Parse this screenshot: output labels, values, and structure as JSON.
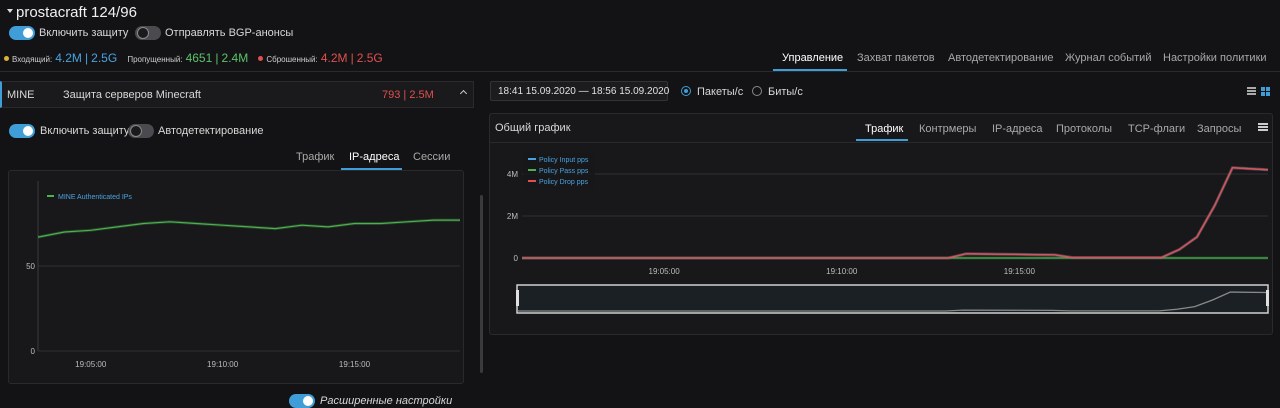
{
  "header": {
    "title": "prostacraft 124/96",
    "enable_protection": "Включить защиту",
    "send_bgp": "Отправлять BGP-анонсы"
  },
  "stats": {
    "incoming_label": "Входящий:",
    "incoming_pps": "4.2M",
    "incoming_bps": "2.5G",
    "passed_label": "Пропущенный:",
    "passed_pps": "4651",
    "passed_bps": "2.4M",
    "dropped_label": "Сброшенный:",
    "dropped_pps": "4.2M",
    "dropped_bps": "2.5G",
    "sep": "|"
  },
  "main_tabs": [
    "Управление",
    "Захват пакетов",
    "Автодетектирование",
    "Журнал событий",
    "Настройки политики"
  ],
  "policy": {
    "name": "MINE",
    "description": "Защита серверов Minecraft",
    "value_pps": "793",
    "value_bps": "2.5M",
    "enable_protection": "Включить защиту",
    "autodetect": "Автодетектирование",
    "tabs": [
      "Трафик",
      "IP-адреса",
      "Сессии"
    ],
    "advanced_settings": "Расширенные настройки"
  },
  "time_range": "18:41 15.09.2020 — 18:56 15.09.2020",
  "units": {
    "packets": "Пакеты/с",
    "bits": "Биты/с",
    "selected": "packets"
  },
  "general_chart": {
    "title": "Общий график",
    "tabs": [
      "Трафик",
      "Контрмеры",
      "IP-адреса",
      "Протоколы",
      "TCP-флаги",
      "Запросы"
    ]
  },
  "chart_data": [
    {
      "type": "line",
      "title": "",
      "series": [
        {
          "name": "MINE Authenticated IPs",
          "color": "#4caf50",
          "x": [
            "19:03",
            "19:04",
            "19:05",
            "19:06",
            "19:07",
            "19:08",
            "19:09",
            "19:10",
            "19:11",
            "19:12",
            "19:13",
            "19:14",
            "19:15",
            "19:16",
            "19:17",
            "19:18",
            "19:19"
          ],
          "values": [
            67,
            70,
            71,
            73,
            75,
            76,
            75,
            74,
            73,
            72,
            74,
            73,
            75,
            75,
            76,
            77,
            77
          ]
        }
      ],
      "x_ticks": [
        "19:05:00",
        "19:10:00",
        "19:15:00"
      ],
      "y_ticks": [
        "0",
        "50"
      ],
      "ylim": [
        0,
        100
      ],
      "legend": "top-left"
    },
    {
      "type": "line",
      "title": "",
      "series": [
        {
          "name": "Policy Input pps",
          "color": "#4aa3df",
          "x": [
            "19:01",
            "19:05",
            "19:10",
            "19:13",
            "19:13.5",
            "19:16",
            "19:16.5",
            "19:19",
            "19:19.5",
            "19:20",
            "19:20.5",
            "19:21",
            "19:22"
          ],
          "values": [
            0,
            0,
            0,
            0,
            0.2,
            0.15,
            0.02,
            0.02,
            0.4,
            1.0,
            2.5,
            4.3,
            4.2
          ]
        },
        {
          "name": "Policy Pass pps",
          "color": "#4caf50",
          "x": [
            "19:01",
            "19:22"
          ],
          "values": [
            0,
            0
          ]
        },
        {
          "name": "Policy Drop pps",
          "color": "#e05050",
          "x": [
            "19:01",
            "19:05",
            "19:10",
            "19:13",
            "19:13.5",
            "19:16",
            "19:16.5",
            "19:19",
            "19:19.5",
            "19:20",
            "19:20.5",
            "19:21",
            "19:22"
          ],
          "values": [
            0,
            0,
            0,
            0,
            0.2,
            0.15,
            0.02,
            0.02,
            0.4,
            1.0,
            2.5,
            4.3,
            4.2
          ]
        }
      ],
      "x_ticks": [
        "19:05:00",
        "19:10:00",
        "19:15:00"
      ],
      "y_ticks": [
        "0",
        "2M",
        "4M"
      ],
      "ylim": [
        0,
        5
      ],
      "legend": "top-left"
    }
  ]
}
